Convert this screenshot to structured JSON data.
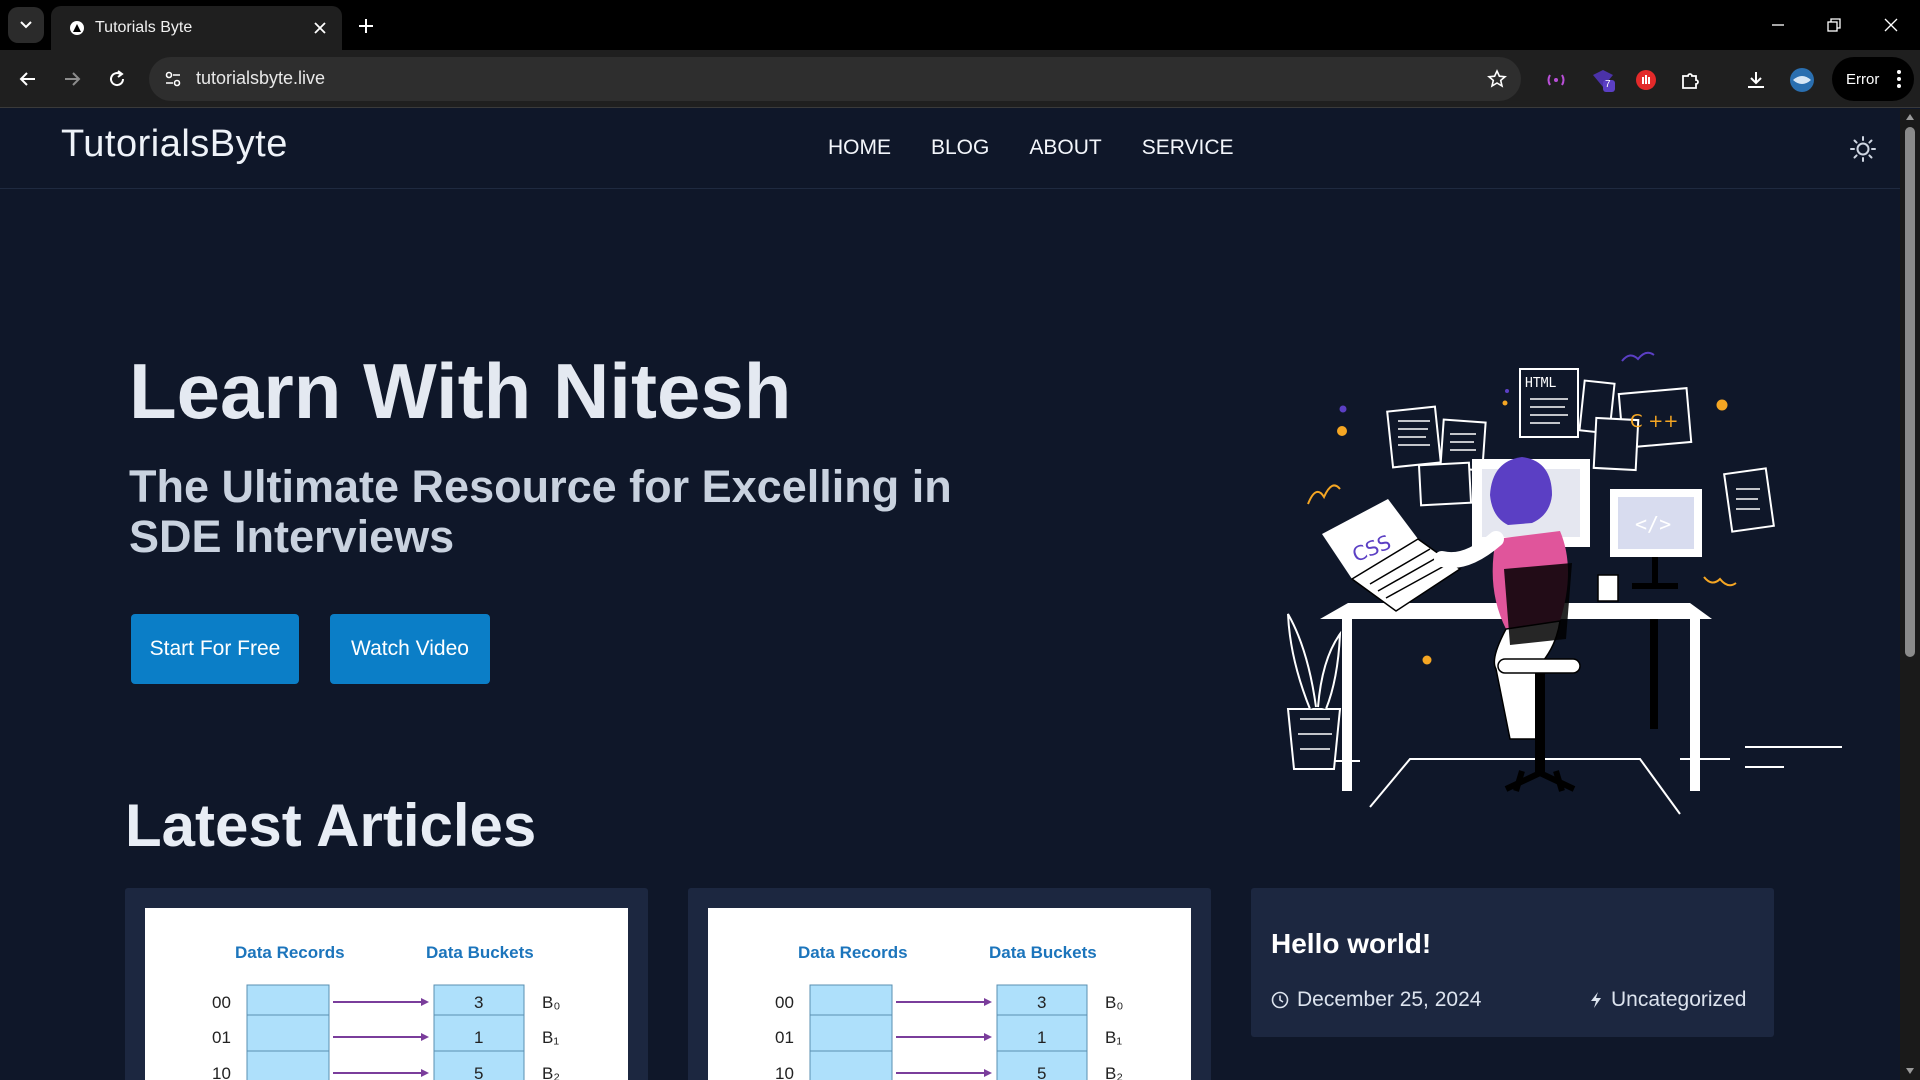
{
  "browser": {
    "tab_title": "Tutorials Byte",
    "url": "tutorialsbyte.live",
    "profile_label": "Error",
    "extension_badge": "7"
  },
  "site": {
    "logo": "TutorialsByte",
    "nav": [
      "HOME",
      "BLOG",
      "ABOUT",
      "SERVICE"
    ]
  },
  "hero": {
    "title": "Learn With Nitesh",
    "subtitle": "The Ultimate Resource for Excelling in SDE Interviews",
    "primary_button": "Start For Free",
    "secondary_button": "Watch Video",
    "illustration_texts": [
      "HTML",
      "C ++",
      "CSS",
      "</>"
    ]
  },
  "articles": {
    "heading": "Latest Articles",
    "diagram": {
      "records_header": "Data Records",
      "buckets_header": "Data Buckets",
      "rows": [
        {
          "key": "00",
          "value": "3",
          "bucket": "B₀"
        },
        {
          "key": "01",
          "value": "1",
          "bucket": "B₁"
        },
        {
          "key": "10",
          "value": "5",
          "bucket": "B₂"
        }
      ]
    },
    "text_card": {
      "title": "Hello world!",
      "date": "December 25, 2024",
      "category": "Uncategorized"
    }
  },
  "colors": {
    "page_bg": "#0f1729",
    "button_bg": "#0b7ec7",
    "card_bg": "#1c2740",
    "accent_purple": "#5b3fc4",
    "accent_pink": "#e0559b",
    "accent_orange": "#f5a623"
  }
}
